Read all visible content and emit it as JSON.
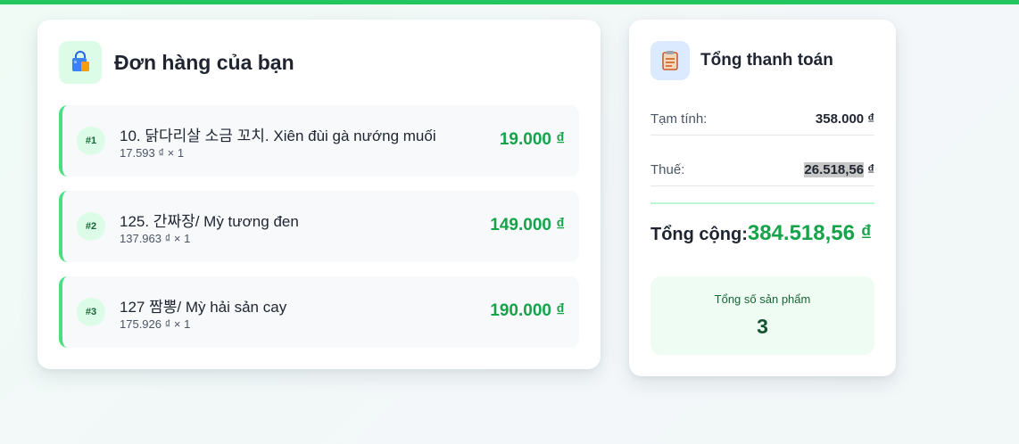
{
  "colors": {
    "accent_green": "#22c55e",
    "price_green": "#16a34a",
    "border_green": "#4ade80"
  },
  "orders": {
    "title": "Đơn hàng của bạn",
    "icon": "shopping-bag-icon",
    "items": [
      {
        "index": "#1",
        "name": "10. 닭다리살 소금 꼬치. Xiên đùi gà nướng muối",
        "sub": "17.593 ₫ × 1",
        "price": "19.000 ₫"
      },
      {
        "index": "#2",
        "name": "125. 간짜장/ Mỳ tương đen",
        "sub": "137.963 ₫ × 1",
        "price": "149.000 ₫"
      },
      {
        "index": "#3",
        "name": "127 짬뽕/ Mỳ hải sản cay",
        "sub": "175.926 ₫ × 1",
        "price": "190.000 ₫"
      }
    ]
  },
  "summary": {
    "title": "Tổng thanh toán",
    "icon": "clipboard-icon",
    "subtotal_label": "Tạm tính:",
    "subtotal_value": "358.000 ₫",
    "tax_label": "Thuế:",
    "tax_value_highlighted": "26.518,56",
    "tax_value_rest": " ₫",
    "total_label": "Tổng cộng:",
    "total_value": "384.518,56 ₫",
    "count_label": "Tổng số sản phẩm",
    "count_value": "3"
  }
}
